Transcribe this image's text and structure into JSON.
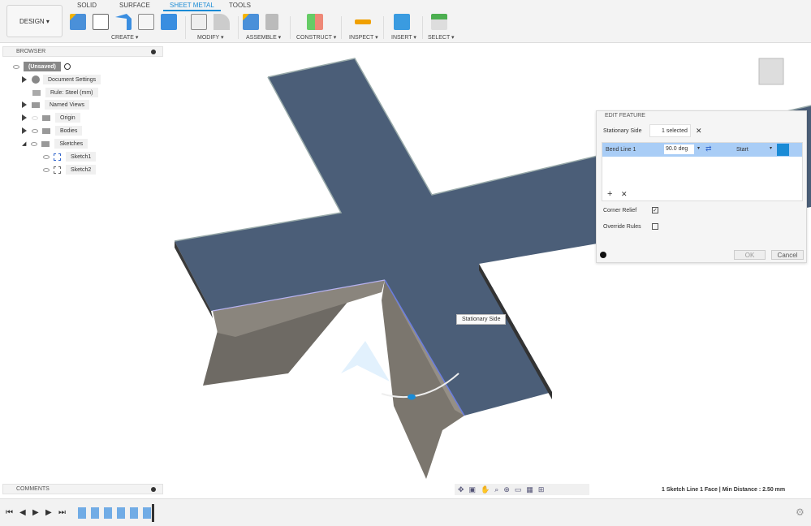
{
  "toolbar": {
    "design_label": "DESIGN ▾",
    "tabs": [
      {
        "label": "SOLID"
      },
      {
        "label": "SURFACE"
      },
      {
        "label": "SHEET METAL",
        "active": true
      },
      {
        "label": "TOOLS"
      }
    ],
    "groups": [
      {
        "label": "CREATE ▾"
      },
      {
        "label": "MODIFY ▾"
      },
      {
        "label": "ASSEMBLE ▾"
      },
      {
        "label": "CONSTRUCT ▾"
      },
      {
        "label": "INSPECT ▾"
      },
      {
        "label": "INSERT ▾"
      },
      {
        "label": "SELECT ▾"
      }
    ],
    "accent": "#1a8bd6"
  },
  "browser": {
    "title": "BROWSER",
    "items": [
      {
        "label": "(Unsaved)"
      },
      {
        "label": "Document Settings"
      },
      {
        "label": "Rule: Steel (mm)"
      },
      {
        "label": "Named Views"
      },
      {
        "label": "Origin"
      },
      {
        "label": "Bodies"
      },
      {
        "label": "Sketches"
      },
      {
        "label": "Sketch1"
      },
      {
        "label": "Sketch2"
      }
    ]
  },
  "edit_feature": {
    "title": "EDIT FEATURE",
    "stationary_side_label": "Stationary Side",
    "selection": "1 selected",
    "bend_line": {
      "name": "Bend Line 1",
      "angle": "90.0 deg",
      "position": "Start"
    },
    "corner_relief_label": "Corner Relief",
    "corner_relief_checked": true,
    "override_rules_label": "Override Rules",
    "override_rules_checked": false,
    "ok_label": "OK",
    "cancel_label": "Cancel"
  },
  "viewport": {
    "tooltip": "Stationary Side"
  },
  "comments": {
    "title": "COMMENTS"
  },
  "status": {
    "text": "1 Sketch Line 1 Face | Min Distance : 2.50 mm"
  }
}
